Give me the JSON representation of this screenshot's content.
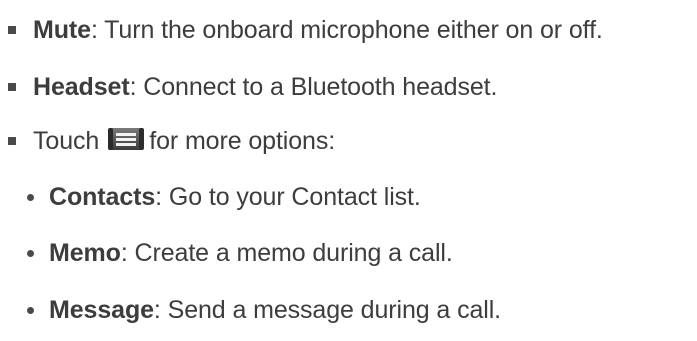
{
  "items": [
    {
      "term": "Mute",
      "desc": ": Turn the onboard microphone either on or off."
    },
    {
      "term": "Headset",
      "desc": ": Connect to a Bluetooth headset."
    },
    {
      "text_before_icon": "Touch",
      "icon": "menu-key-icon",
      "text_after_icon": " for more options:"
    }
  ],
  "sub_items": [
    {
      "term": "Contacts",
      "desc": ": Go to your Contact list."
    },
    {
      "term": "Memo",
      "desc": ": Create a memo during a call."
    },
    {
      "term": "Message",
      "desc": ": Send a message during a call."
    }
  ]
}
